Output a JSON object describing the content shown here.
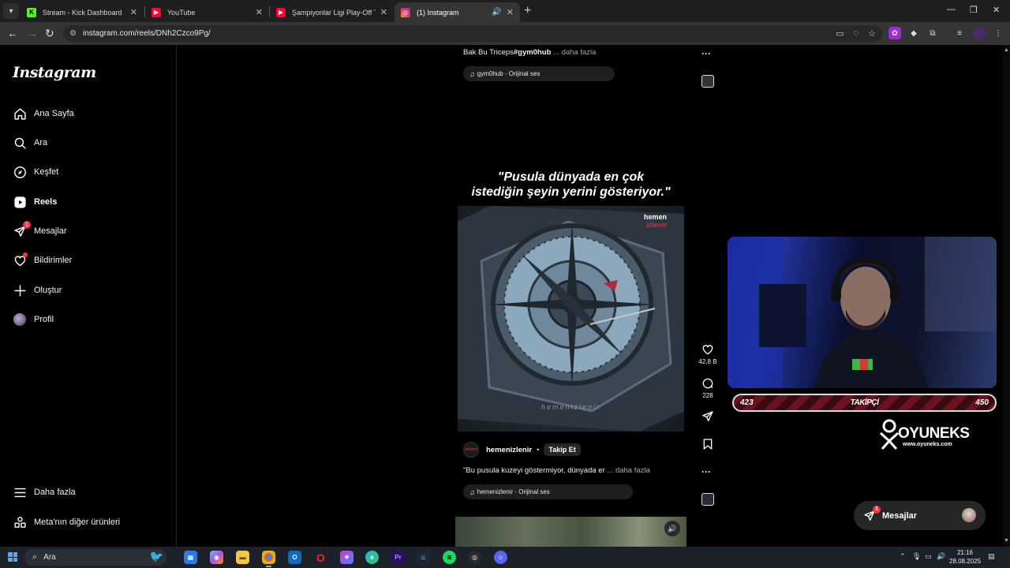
{
  "browser": {
    "tabs": [
      {
        "title": "Stream - Kick Dashboard",
        "favicon": "kick-logo-icon",
        "active": false
      },
      {
        "title": "YouTube",
        "favicon": "youtube-icon",
        "active": false
      },
      {
        "title": "Şampiyonlar Ligi Play-Off Turu",
        "favicon": "youtube-icon",
        "active": false
      },
      {
        "title": "(1) Instagram",
        "favicon": "instagram-icon",
        "active": true
      }
    ],
    "url": "instagram.com/reels/DNh2Czco9Pg/"
  },
  "instagram": {
    "logo": "Instagram",
    "nav": [
      {
        "label": "Ana Sayfa",
        "icon": "home-icon"
      },
      {
        "label": "Ara",
        "icon": "search-icon"
      },
      {
        "label": "Keşfet",
        "icon": "compass-icon"
      },
      {
        "label": "Reels",
        "icon": "reels-icon",
        "active": true
      },
      {
        "label": "Mesajlar",
        "icon": "messenger-icon",
        "badge": "1"
      },
      {
        "label": "Bildirimler",
        "icon": "heart-icon",
        "dot": true
      },
      {
        "label": "Oluştur",
        "icon": "plus-icon"
      },
      {
        "label": "Profil",
        "icon": "avatar-icon"
      }
    ],
    "more": {
      "label": "Daha fazla",
      "icon": "menu-icon"
    },
    "meta": {
      "label": "Meta'nın diğer ürünleri",
      "icon": "meta-apps-icon"
    }
  },
  "reel_prev": {
    "caption_text": "Bak Bu Triceps",
    "caption_tag": "#gym0hub",
    "caption_more": " ... daha fazla",
    "audio": "gym0hub · Orijinal ses"
  },
  "reel": {
    "quote_line1": "\"Pusula dünyada en çok",
    "quote_line2": "istediğin şeyin yerini gösteriyor.\"",
    "watermark_top1": "hemen",
    "watermark_top2": "izlenir",
    "watermark_bottom": "hemenizlenir",
    "author": "hemenizlenir",
    "follow_label": "Takip Et",
    "caption": "\"Bu pusula kuzeyi göstermiyor, dünyada er",
    "caption_more": " ... daha fazla",
    "audio": "hemenizlenir · Orijinal ses",
    "likes": "42,8 B",
    "comments": "228"
  },
  "stream": {
    "follower_current": "423",
    "follower_label": "TAKİPÇİ",
    "follower_goal": "450",
    "follower_progress": 0.94,
    "brand_name": "OYUNEKS",
    "brand_url": "www.oyuneks.com"
  },
  "messages_pill": {
    "label": "Mesajlar",
    "badge": "1"
  },
  "taskbar": {
    "search_placeholder": "Ara",
    "time": "21:16",
    "date": "28.08.2025"
  },
  "colors": {
    "instagram_red": "#ff3040",
    "kick_green": "#53fc18",
    "youtube_red": "#ff0033",
    "follower_bar": "#6b1220"
  }
}
